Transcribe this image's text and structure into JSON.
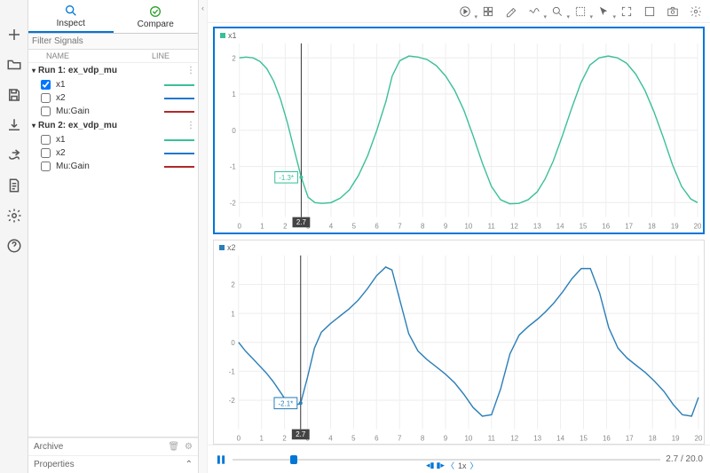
{
  "tabs": {
    "inspect": "Inspect",
    "compare": "Compare"
  },
  "filter_placeholder": "Filter Signals",
  "headers": {
    "name": "NAME",
    "line": "LINE"
  },
  "runs": [
    {
      "label": "Run 1: ex_vdp_mu",
      "signals": [
        {
          "name": "x1",
          "checked": true,
          "color": "#3bbf9a"
        },
        {
          "name": "x2",
          "checked": false,
          "color": "#1f77d0"
        },
        {
          "name": "Mu:Gain",
          "checked": false,
          "color": "#b02a2a"
        }
      ]
    },
    {
      "label": "Run 2: ex_vdp_mu",
      "signals": [
        {
          "name": "x1",
          "checked": false,
          "color": "#3bbf9a"
        },
        {
          "name": "x2",
          "checked": false,
          "color": "#1f77d0"
        },
        {
          "name": "Mu:Gain",
          "checked": false,
          "color": "#b02a2a"
        }
      ]
    }
  ],
  "sections": {
    "archive": "Archive",
    "properties": "Properties"
  },
  "chart_data": [
    {
      "type": "line",
      "title": "x1",
      "color": "#3bbf9a",
      "xlim": [
        0,
        20
      ],
      "ylim": [
        -2.4,
        2.4
      ],
      "xticks": [
        0,
        1,
        2,
        3,
        4,
        5,
        6,
        7,
        8,
        9,
        10,
        11,
        12,
        13,
        14,
        15,
        16,
        17,
        18,
        19,
        20
      ],
      "yticks": [
        -2,
        -1,
        0,
        1,
        2
      ],
      "cursor_x": 2.7,
      "cursor_y": -1.3,
      "cursor_y_label": "-1.3*",
      "x": [
        0,
        0.3,
        0.6,
        0.9,
        1.2,
        1.5,
        1.8,
        2.1,
        2.4,
        2.7,
        3.0,
        3.3,
        3.6,
        4.0,
        4.4,
        4.8,
        5.2,
        5.6,
        6.0,
        6.4,
        6.67,
        7.0,
        7.4,
        7.8,
        8.2,
        8.6,
        9.0,
        9.4,
        9.8,
        10.2,
        10.6,
        11.0,
        11.4,
        11.8,
        12.2,
        12.6,
        13.0,
        13.34,
        13.7,
        14.1,
        14.5,
        14.9,
        15.3,
        15.7,
        16.1,
        16.5,
        16.9,
        17.3,
        17.7,
        18.1,
        18.5,
        18.9,
        19.3,
        19.7,
        20.0
      ],
      "y": [
        2.0,
        2.02,
        2.0,
        1.9,
        1.7,
        1.35,
        0.85,
        0.2,
        -0.55,
        -1.3,
        -1.85,
        -2.0,
        -2.02,
        -2.0,
        -1.88,
        -1.65,
        -1.25,
        -0.7,
        0.0,
        0.8,
        1.5,
        1.92,
        2.05,
        2.02,
        1.95,
        1.78,
        1.5,
        1.1,
        0.55,
        -0.15,
        -0.9,
        -1.55,
        -1.92,
        -2.03,
        -2.02,
        -1.92,
        -1.7,
        -1.35,
        -0.85,
        -0.15,
        0.6,
        1.3,
        1.8,
        2.0,
        2.05,
        2.0,
        1.85,
        1.55,
        1.1,
        0.5,
        -0.2,
        -0.95,
        -1.55,
        -1.9,
        -2.0
      ]
    },
    {
      "type": "line",
      "title": "x2",
      "color": "#2b7fb8",
      "xlim": [
        0,
        20
      ],
      "ylim": [
        -3,
        3
      ],
      "xticks": [
        0,
        1,
        2,
        3,
        4,
        5,
        6,
        7,
        8,
        9,
        10,
        11,
        12,
        13,
        14,
        15,
        16,
        17,
        18,
        19,
        20
      ],
      "yticks": [
        -2,
        -1,
        0,
        1,
        2
      ],
      "cursor_x": 2.7,
      "cursor_y": -2.1,
      "cursor_y_label": "-2.1*",
      "x": [
        0,
        0.3,
        0.6,
        0.9,
        1.2,
        1.5,
        1.8,
        2.1,
        2.4,
        2.7,
        3.0,
        3.3,
        3.6,
        4.0,
        4.4,
        4.8,
        5.2,
        5.6,
        6.0,
        6.4,
        6.67,
        7.0,
        7.4,
        7.8,
        8.2,
        8.6,
        9.0,
        9.4,
        9.8,
        10.2,
        10.6,
        11.0,
        11.4,
        11.8,
        12.2,
        12.6,
        13.0,
        13.34,
        13.7,
        14.1,
        14.5,
        14.9,
        15.3,
        15.7,
        16.1,
        16.5,
        16.9,
        17.3,
        17.7,
        18.1,
        18.5,
        18.9,
        19.3,
        19.7,
        20.0
      ],
      "y": [
        0.0,
        -0.3,
        -0.55,
        -0.8,
        -1.05,
        -1.35,
        -1.7,
        -2.05,
        -2.2,
        -2.1,
        -1.2,
        -0.2,
        0.35,
        0.65,
        0.9,
        1.15,
        1.45,
        1.85,
        2.3,
        2.6,
        2.5,
        1.5,
        0.3,
        -0.3,
        -0.6,
        -0.85,
        -1.1,
        -1.4,
        -1.8,
        -2.25,
        -2.55,
        -2.5,
        -1.6,
        -0.4,
        0.25,
        0.55,
        0.8,
        1.05,
        1.35,
        1.75,
        2.2,
        2.55,
        2.55,
        1.7,
        0.5,
        -0.2,
        -0.55,
        -0.8,
        -1.05,
        -1.35,
        -1.7,
        -2.15,
        -2.5,
        -2.55,
        -1.9
      ]
    }
  ],
  "playback": {
    "current": "2.7",
    "total": "20.0",
    "speed": "1x"
  }
}
